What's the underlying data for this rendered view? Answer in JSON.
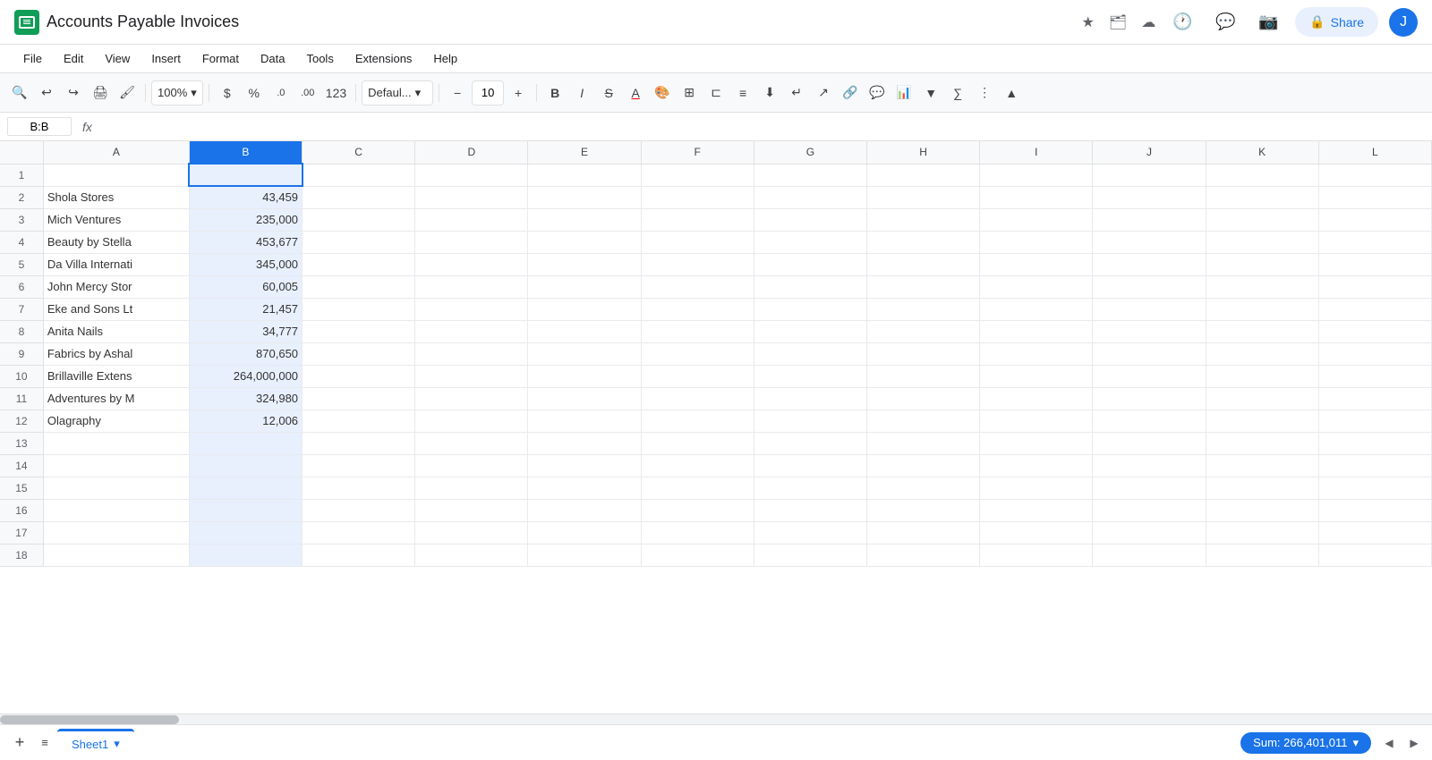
{
  "app": {
    "icon_color": "#0f9d58",
    "title": "Accounts Payable Invoices",
    "subtitle": "Accounts Payable Invoices"
  },
  "title_icons": [
    "★",
    "🗂",
    "☁"
  ],
  "header": {
    "history_icon": "🕐",
    "comment_icon": "💬",
    "video_icon": "📷",
    "share_label": "Share",
    "user_initial": "J"
  },
  "menu": {
    "items": [
      "File",
      "Edit",
      "View",
      "Insert",
      "Format",
      "Data",
      "Tools",
      "Extensions",
      "Help"
    ]
  },
  "toolbar": {
    "zoom": "100%",
    "currency_symbol": "$",
    "percent_symbol": "%",
    "decimal_less": ".0",
    "decimal_more": ".00",
    "number_123": "123",
    "font_name": "Defaul...",
    "font_size": "10",
    "bold": "B",
    "italic": "I",
    "strikethrough": "S̶",
    "more_icon": "⋮"
  },
  "formula_bar": {
    "cell_ref": "B:B",
    "formula_icon": "fx",
    "formula_value": ""
  },
  "columns": [
    "",
    "A",
    "B",
    "C",
    "D",
    "E",
    "F",
    "G",
    "H",
    "I",
    "J",
    "K",
    "L"
  ],
  "selected_column": "B",
  "rows": [
    {
      "row": 1,
      "a": "",
      "b": ""
    },
    {
      "row": 2,
      "a": "Shola Stores",
      "b": "43,459"
    },
    {
      "row": 3,
      "a": "Mich Ventures",
      "b": "235,000"
    },
    {
      "row": 4,
      "a": "Beauty by Stella",
      "b": "453,677"
    },
    {
      "row": 5,
      "a": "Da Villa Internati",
      "b": "345,000"
    },
    {
      "row": 6,
      "a": "John Mercy Stor",
      "b": "60,005"
    },
    {
      "row": 7,
      "a": "Eke and Sons Lt",
      "b": "21,457"
    },
    {
      "row": 8,
      "a": "Anita Nails",
      "b": "34,777"
    },
    {
      "row": 9,
      "a": "Fabrics by Ashal",
      "b": "870,650"
    },
    {
      "row": 10,
      "a": "Brillaville Extens",
      "b": "264,000,000"
    },
    {
      "row": 11,
      "a": "Adventures by M",
      "b": "324,980"
    },
    {
      "row": 12,
      "a": "Olagraphy",
      "b": "12,006"
    },
    {
      "row": 13,
      "a": "",
      "b": ""
    },
    {
      "row": 14,
      "a": "",
      "b": ""
    },
    {
      "row": 15,
      "a": "",
      "b": ""
    },
    {
      "row": 16,
      "a": "",
      "b": ""
    },
    {
      "row": 17,
      "a": "",
      "b": ""
    },
    {
      "row": 18,
      "a": "",
      "b": ""
    }
  ],
  "sheet": {
    "tab_label": "Sheet1",
    "sum_label": "Sum: 266,401,011"
  }
}
